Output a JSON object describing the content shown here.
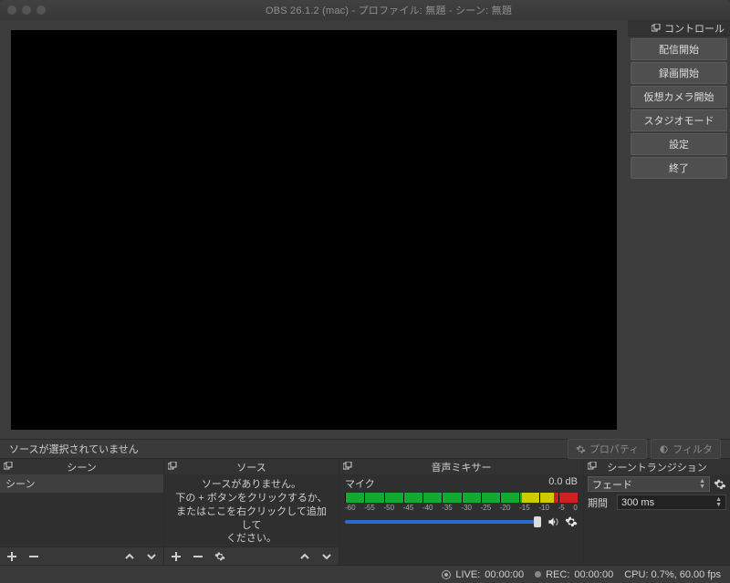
{
  "title": "OBS 26.1.2 (mac) - プロファイル: 無題 - シーン: 無題",
  "controls": {
    "title": "コントロール",
    "buttons": [
      "配信開始",
      "録画開始",
      "仮想カメラ開始",
      "スタジオモード",
      "設定",
      "終了"
    ]
  },
  "notice": {
    "no_source_selected": "ソースが選択されていません",
    "properties": "プロパティ",
    "filters": "フィルタ"
  },
  "panels": {
    "scenes": {
      "title": "シーン",
      "items": [
        "シーン"
      ]
    },
    "sources": {
      "title": "ソース",
      "empty_lines": [
        "ソースがありません。",
        "下の + ボタンをクリックするか、",
        "またはここを右クリックして追加して",
        "ください。"
      ]
    },
    "mixer": {
      "title": "音声ミキサー",
      "track_name": "マイク",
      "level": "0.0 dB",
      "scale": [
        "-60",
        "-55",
        "-50",
        "-45",
        "-40",
        "-35",
        "-30",
        "-25",
        "-20",
        "-15",
        "-10",
        "-5",
        "0"
      ]
    },
    "transitions": {
      "title": "シーントランジション",
      "selected": "フェード",
      "duration_label": "期間",
      "duration_value": "300 ms"
    }
  },
  "statusbar": {
    "live_label": "LIVE:",
    "live_time": "00:00:00",
    "rec_label": "REC:",
    "rec_time": "00:00:00",
    "cpu": "CPU: 0.7%, 60.00 fps"
  }
}
